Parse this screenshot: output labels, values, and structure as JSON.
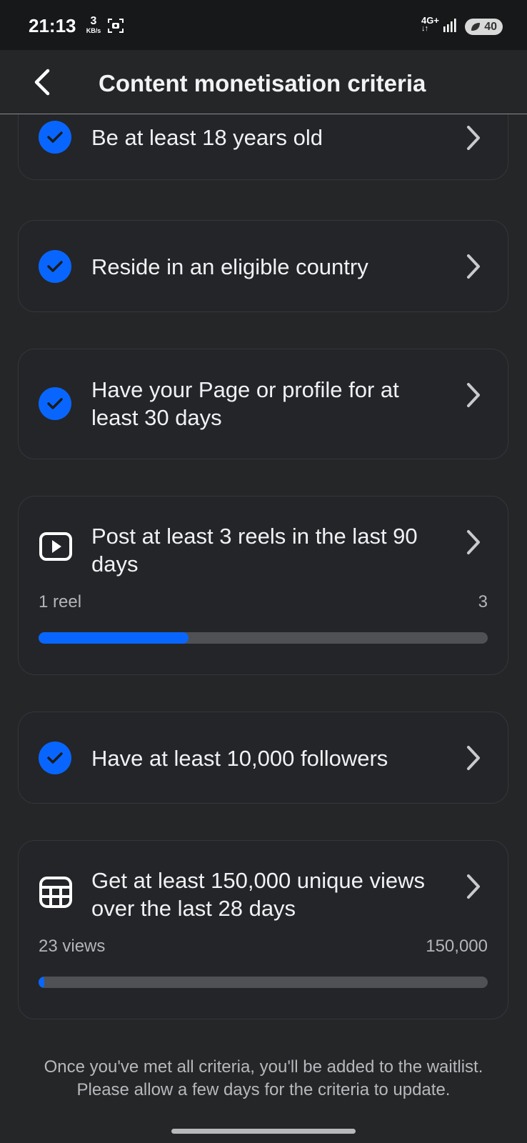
{
  "status_bar": {
    "time": "21:13",
    "speed_value": "3",
    "speed_unit": "KB/s",
    "network": "4G+",
    "battery": "40"
  },
  "header": {
    "title": "Content monetisation criteria"
  },
  "criteria": [
    {
      "icon": "check-circle-icon",
      "label": "Be at least 18 years old",
      "met": true
    },
    {
      "icon": "check-circle-icon",
      "label": "Reside in an eligible country",
      "met": true
    },
    {
      "icon": "check-circle-icon",
      "label": "Have your Page or profile for at least 30 days",
      "met": true
    },
    {
      "icon": "reels-play-icon",
      "label": "Post at least 3 reels in the last 90 days",
      "met": false,
      "progress": {
        "current_label": "1 reel",
        "target_label": "3",
        "current": 1,
        "target": 3
      }
    },
    {
      "icon": "check-circle-icon",
      "label": "Have at least 10,000 followers",
      "met": true
    },
    {
      "icon": "views-grid-icon",
      "label": "Get at least 150,000 unique views over the last 28 days",
      "met": false,
      "progress": {
        "current_label": "23 views",
        "target_label": "150,000",
        "current": 23,
        "target": 150000
      }
    }
  ],
  "footer": {
    "note": "Once you've met all criteria, you'll be added to the waitlist. Please allow a few days for the criteria to update."
  },
  "colors": {
    "accent": "#0866ff",
    "background": "#252628"
  }
}
